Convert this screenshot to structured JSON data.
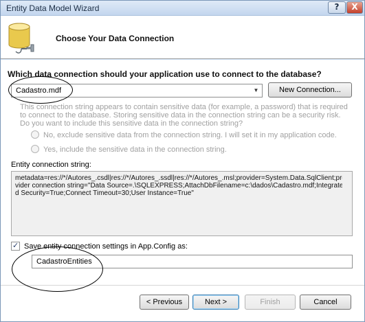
{
  "window": {
    "title": "Entity Data Model Wizard"
  },
  "titlebar": {
    "help_label": "?",
    "close_label": "X"
  },
  "header": {
    "title": "Choose Your Data Connection"
  },
  "connection": {
    "question": "Which data connection should your application use to connect to the database?",
    "selected": "Cadastro.mdf",
    "new_connection_label": "New Connection..."
  },
  "sensitive": {
    "text": "This connection string appears to contain sensitive data (for example, a password) that is required to connect to the database. Storing sensitive data in the connection string can be a security risk. Do you want to include this sensitive data in the connection string?",
    "option_no": "No, exclude sensitive data from the connection string. I will set it in my application code.",
    "option_yes": "Yes, include the sensitive data in the connection string."
  },
  "entity_connection": {
    "label": "Entity connection string:",
    "value": "metadata=res://*/Autores_.csdl|res://*/Autores_.ssdl|res://*/Autores_.msl;provider=System.Data.SqlClient;provider connection string=\"Data Source=.\\SQLEXPRESS;AttachDbFilename=c:\\dados\\Cadastro.mdf;Integrated Security=True;Connect Timeout=30;User Instance=True\""
  },
  "save_settings": {
    "checked": true,
    "label": "Save entity connection settings in App.Config as:",
    "value": "CadastroEntities"
  },
  "footer": {
    "previous_label": "< Previous",
    "next_label": "Next >",
    "finish_label": "Finish",
    "cancel_label": "Cancel"
  },
  "colors": {
    "frame": "#c9dcf1",
    "close_button": "#c4402b",
    "disabled_text": "#a0a0a0"
  }
}
